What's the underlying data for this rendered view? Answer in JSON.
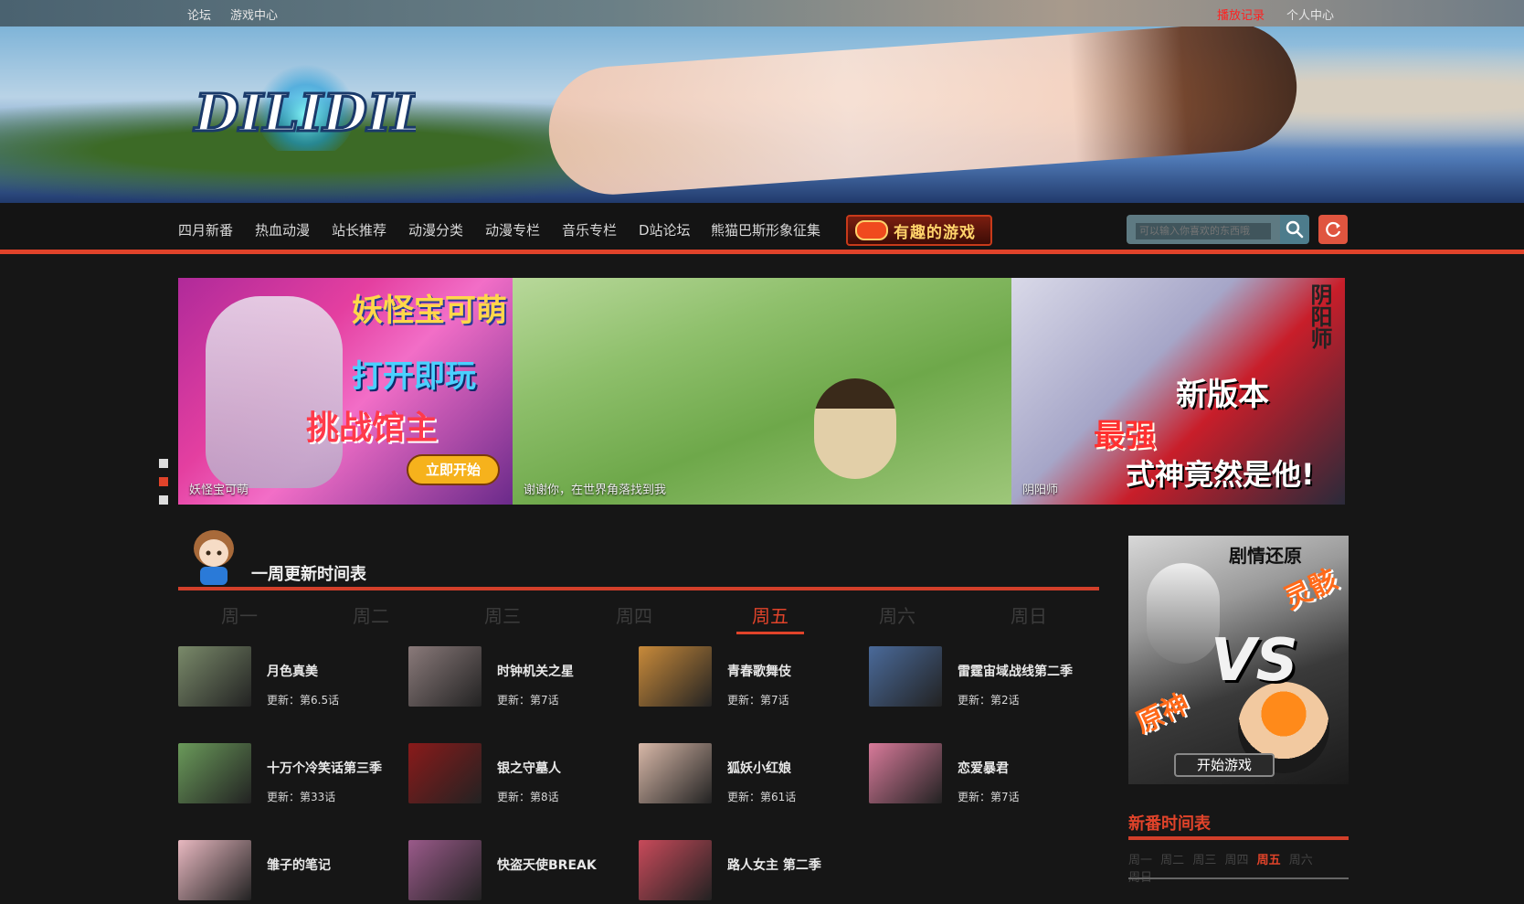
{
  "topbar": {
    "links_left": [
      "论坛",
      "游戏中心"
    ],
    "history": "播放记录",
    "user_center": "个人中心"
  },
  "banner": {
    "logo_text": "DILIDILI"
  },
  "nav": {
    "items": [
      "四月新番",
      "热血动漫",
      "站长推荐",
      "动漫分类",
      "动漫专栏",
      "音乐专栏",
      "D站论坛",
      "熊猫巴斯形象征集"
    ],
    "game_label": "有趣的游戏",
    "search_placeholder": "可以输入你喜欢的东西哦"
  },
  "slider": {
    "slides": [
      {
        "caption": "妖怪宝可萌",
        "text1": "妖怪宝可萌",
        "text2": "打开即玩",
        "text3": "挑战馆主",
        "button": "立即开始"
      },
      {
        "caption": "谢谢你，在世界角落找到我"
      },
      {
        "caption": "阴阳师",
        "text1": "新版本",
        "text2": "最强",
        "text3": "式神竟然是他!",
        "side": "阴阳师"
      }
    ]
  },
  "schedule": {
    "title": "一周更新时间表",
    "days": [
      "周一",
      "周二",
      "周三",
      "周四",
      "周五",
      "周六",
      "周日"
    ],
    "active_day": "周五",
    "items": [
      {
        "name": "月色真美",
        "update": "更新：第6.5话",
        "color": "#7a8a6a"
      },
      {
        "name": "时钟机关之星",
        "update": "更新：第7话",
        "color": "#8a7a7a"
      },
      {
        "name": "青春歌舞伎",
        "update": "更新：第7话",
        "color": "#c88a3a"
      },
      {
        "name": "雷霆宙域战线第二季",
        "update": "更新：第2话",
        "color": "#4a6a9a"
      },
      {
        "name": "十万个冷笑话第三季",
        "update": "更新：第33话",
        "color": "#6a9a5a"
      },
      {
        "name": "银之守墓人",
        "update": "更新：第8话",
        "color": "#8a1a1a"
      },
      {
        "name": "狐妖小红娘",
        "update": "更新：第61话",
        "color": "#d8b8a8"
      },
      {
        "name": "恋爱暴君",
        "update": "更新：第7话",
        "color": "#d87a9a"
      },
      {
        "name": "雏子的笔记",
        "update": "",
        "color": "#e8b8c0"
      },
      {
        "name": "快盗天使BREAK",
        "update": "",
        "color": "#9a5a8a"
      },
      {
        "name": "路人女主 第二季",
        "update": "",
        "color": "#c84a5a"
      }
    ]
  },
  "sidebar": {
    "ad": {
      "top": "剧情还原",
      "b1": "灵骸",
      "vs": "VS",
      "b2": "原神",
      "play": "开始游戏"
    },
    "title": "新番时间表",
    "days": [
      "周一",
      "周二",
      "周三",
      "周四",
      "周五",
      "周六",
      "周日"
    ],
    "active_day": "周五"
  },
  "colors": {
    "accent": "#e0432a",
    "background": "#161616"
  }
}
